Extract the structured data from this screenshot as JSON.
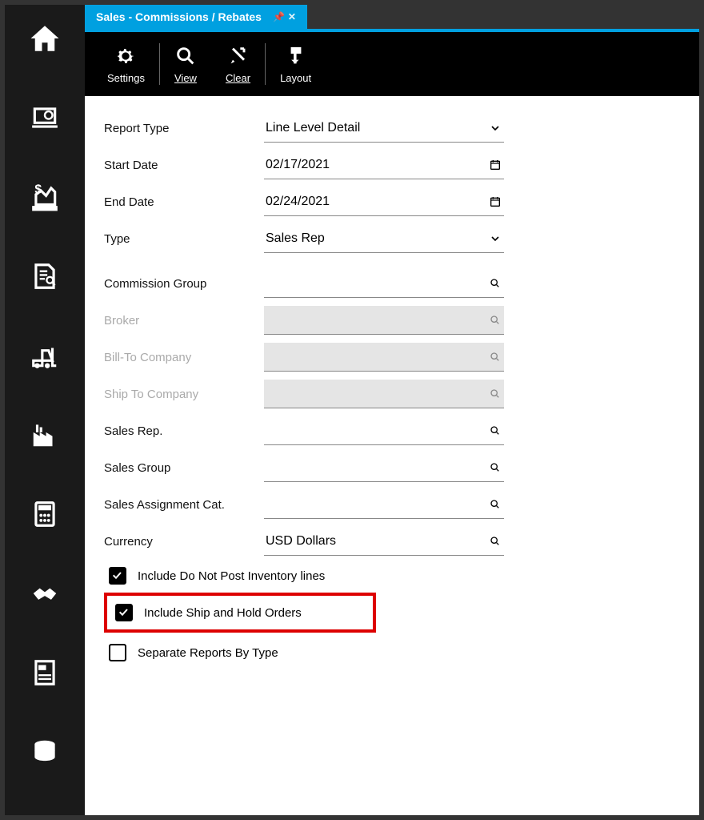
{
  "tab": {
    "title": "Sales - Commissions / Rebates"
  },
  "toolbar": {
    "settings": "Settings",
    "view": "View",
    "clear": "Clear",
    "layout": "Layout"
  },
  "fields": {
    "reportType": {
      "label": "Report Type",
      "value": "Line Level Detail"
    },
    "startDate": {
      "label": "Start Date",
      "value": "02/17/2021"
    },
    "endDate": {
      "label": "End Date",
      "value": "02/24/2021"
    },
    "type": {
      "label": "Type",
      "value": "Sales Rep"
    },
    "commissionGroup": {
      "label": "Commission Group",
      "value": ""
    },
    "broker": {
      "label": "Broker",
      "value": ""
    },
    "billTo": {
      "label": "Bill-To Company",
      "value": ""
    },
    "shipTo": {
      "label": "Ship To Company",
      "value": ""
    },
    "salesRep": {
      "label": "Sales Rep.",
      "value": ""
    },
    "salesGroup": {
      "label": "Sales Group",
      "value": ""
    },
    "salesAssignCat": {
      "label": "Sales Assignment Cat.",
      "value": ""
    },
    "currency": {
      "label": "Currency",
      "value": "USD Dollars"
    }
  },
  "checks": {
    "includeDNP": {
      "label": "Include Do Not Post Inventory lines",
      "checked": true
    },
    "includeShipHold": {
      "label": "Include Ship and Hold Orders",
      "checked": true
    },
    "separateByType": {
      "label": "Separate Reports By Type",
      "checked": false
    }
  }
}
